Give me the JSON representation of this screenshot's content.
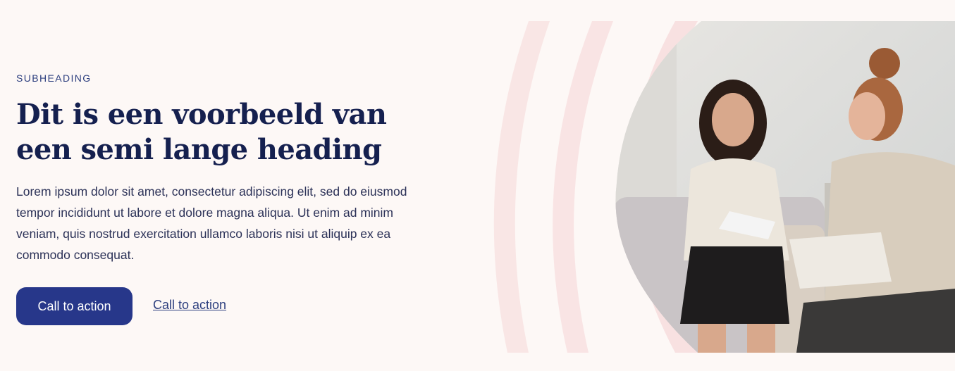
{
  "hero": {
    "subheading": "SUBHEADING",
    "heading": "Dit is een voorbeeld van een semi lange heading",
    "body": "Lorem ipsum dolor sit amet, consectetur adipiscing elit, sed do eiusmod tempor incididunt ut labore et dolore magna aliqua. Ut enim ad minim veniam, quis nostrud exercitation ullamco laboris nisi ut aliquip ex ea commodo consequat.",
    "primary_cta": "Call to action",
    "secondary_cta": "Call to action"
  },
  "colors": {
    "background": "#fdf8f6",
    "heading": "#15204f",
    "accent": "#27378a",
    "arc": "#f9e4e4"
  },
  "image": {
    "subject": "two women sitting on a couch, one holding a notebook, the other writing"
  }
}
